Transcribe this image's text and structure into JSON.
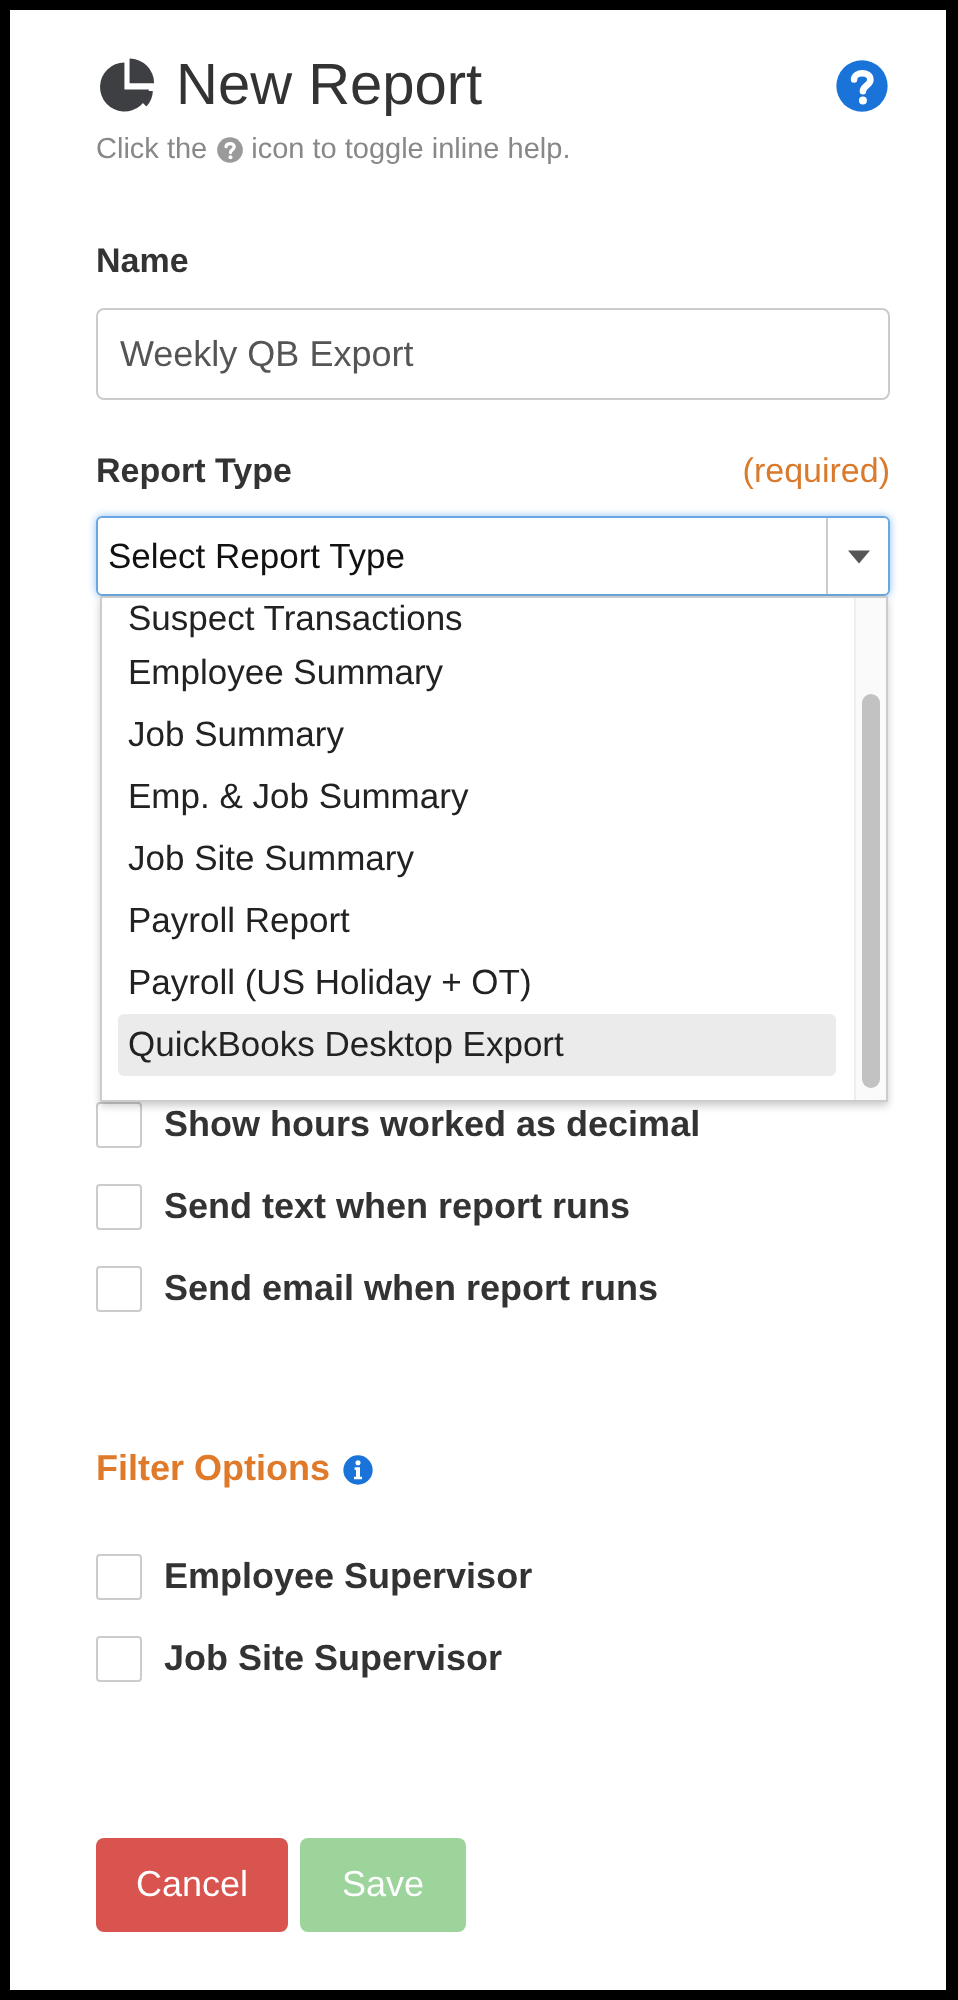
{
  "header": {
    "title": "New Report",
    "hint_before": "Click the",
    "hint_after": "icon to toggle inline help."
  },
  "name_field": {
    "label": "Name",
    "value": "Weekly QB Export"
  },
  "report_type": {
    "label": "Report Type",
    "required": "(required)",
    "value": "Select Report Type",
    "expanded": true,
    "options": [
      {
        "label": "Suspect Transactions",
        "selected": false
      },
      {
        "label": "Employee Summary",
        "selected": false
      },
      {
        "label": "Job Summary",
        "selected": false
      },
      {
        "label": "Emp. & Job Summary",
        "selected": false
      },
      {
        "label": "Job Site Summary",
        "selected": false
      },
      {
        "label": "Payroll Report",
        "selected": false
      },
      {
        "label": "Payroll (US Holiday + OT)",
        "selected": false
      },
      {
        "label": "QuickBooks Desktop Export",
        "selected": true
      }
    ]
  },
  "options": [
    {
      "label": "Show hours worked as decimal",
      "checked": false
    },
    {
      "label": "Send text when report runs",
      "checked": false
    },
    {
      "label": "Send email when report runs",
      "checked": false
    }
  ],
  "filter_options": {
    "title": "Filter Options",
    "items": [
      {
        "label": "Employee Supervisor",
        "checked": false
      },
      {
        "label": "Job Site Supervisor",
        "checked": false
      }
    ]
  },
  "buttons": [
    {
      "label": "Cancel",
      "kind": "cancel",
      "disabled": false
    },
    {
      "label": "Save",
      "kind": "save",
      "disabled": true
    }
  ]
}
